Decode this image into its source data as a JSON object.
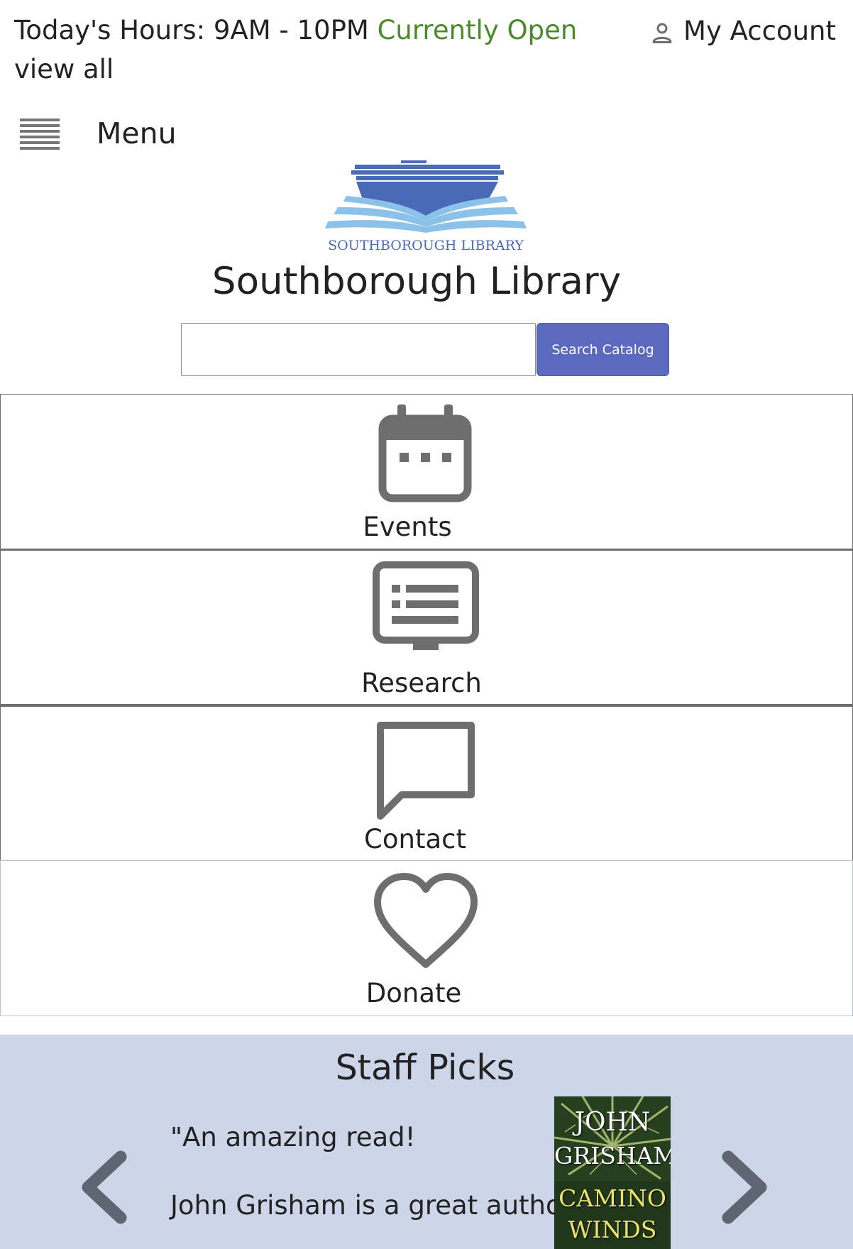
{
  "top_bar": {
    "hours_label": "Today's Hours: 9AM - 10PM",
    "status": "Currently Open",
    "view_all": "view all",
    "account_label": "My Account"
  },
  "menu": {
    "label": "Menu"
  },
  "branding": {
    "logo_text": "SOUTHBOROUGH LIBRARY",
    "site_title": "Southborough Library"
  },
  "search": {
    "value": "",
    "button_label": "Search Catalog"
  },
  "nav_tiles": [
    {
      "label": "Events",
      "icon": "calendar-icon"
    },
    {
      "label": "Research",
      "icon": "monitor-list-icon"
    },
    {
      "label": "Contact",
      "icon": "chat-bubble-icon"
    },
    {
      "label": "Donate",
      "icon": "heart-icon"
    }
  ],
  "staff_picks": {
    "title": "Staff Picks",
    "quote_line_1": "\"An amazing read!",
    "quote_line_2": "John Grisham is a great author.\"",
    "book": {
      "author_first": "JOHN",
      "author_last": "GRISHAM",
      "title_1": "CAMINO",
      "title_2": "WINDS"
    },
    "prev_icon": "chevron-left-icon",
    "next_icon": "chevron-right-icon"
  },
  "colors": {
    "open_status": "#4b8a2b",
    "search_button": "#5b6abf",
    "staff_picks_bg": "#cdd6e9",
    "icon_gray": "#6e6e6e",
    "logo_dark_blue": "#4a6ab8",
    "logo_light_blue": "#8cc1ea"
  }
}
